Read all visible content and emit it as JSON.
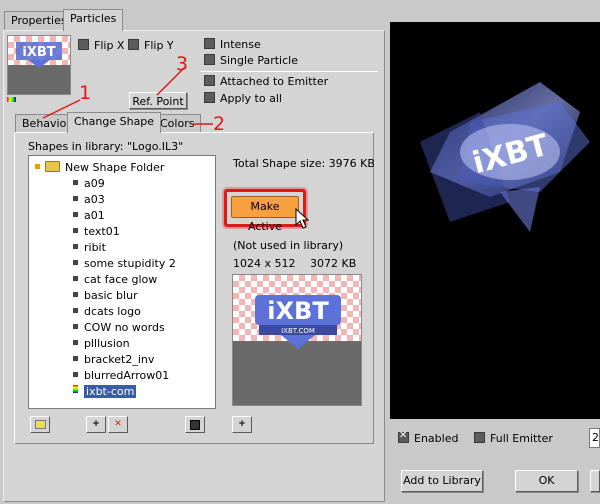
{
  "tabs": [
    {
      "label": "Properties",
      "active": false
    },
    {
      "label": "Particles",
      "active": true
    }
  ],
  "options": {
    "flip_x": "Flip X",
    "flip_y": "Flip Y",
    "intense": "Intense",
    "single_particle": "Single Particle",
    "attached_to_emitter": "Attached to Emitter",
    "apply_to_all": "Apply to all"
  },
  "ref_point_label": "Ref. Point",
  "subtabs": [
    {
      "label": "Behavior",
      "active": false
    },
    {
      "label": "Change Shape",
      "active": true
    },
    {
      "label": "Colors",
      "active": false
    }
  ],
  "annotations": [
    "1",
    "2",
    "3"
  ],
  "library": {
    "label": "Shapes in library: \"Logo.IL3\"",
    "total_size": "Total Shape size: 3976 KB",
    "make_active_label": "Make Active",
    "not_used": "(Not used in library)",
    "dimensions": "1024 x 512",
    "size": "3072 KB",
    "folder": "New Shape Folder",
    "items": [
      "a09",
      "a03",
      "a01",
      "text01",
      "ribit",
      "some stupidity 2",
      "cat face glow",
      "basic blur",
      "dcats logo",
      "COW no words",
      "plllusion",
      "bracket2_inv",
      "blurredArrow01",
      "ixbt-com"
    ],
    "selected_index": 13
  },
  "logo_text": "iXBT",
  "logo_sub": "IXBT.COM",
  "bottom": {
    "enabled": "Enabled",
    "full_emitter": "Full Emitter",
    "number_field": "2",
    "add_to_library": "Add to Library",
    "ok": "OK"
  },
  "colors": {
    "accent_red": "#e01818",
    "make_active_orange": "#f7a040",
    "selection_blue": "#3a5ba8",
    "logo_blue": "#5c72d8"
  }
}
